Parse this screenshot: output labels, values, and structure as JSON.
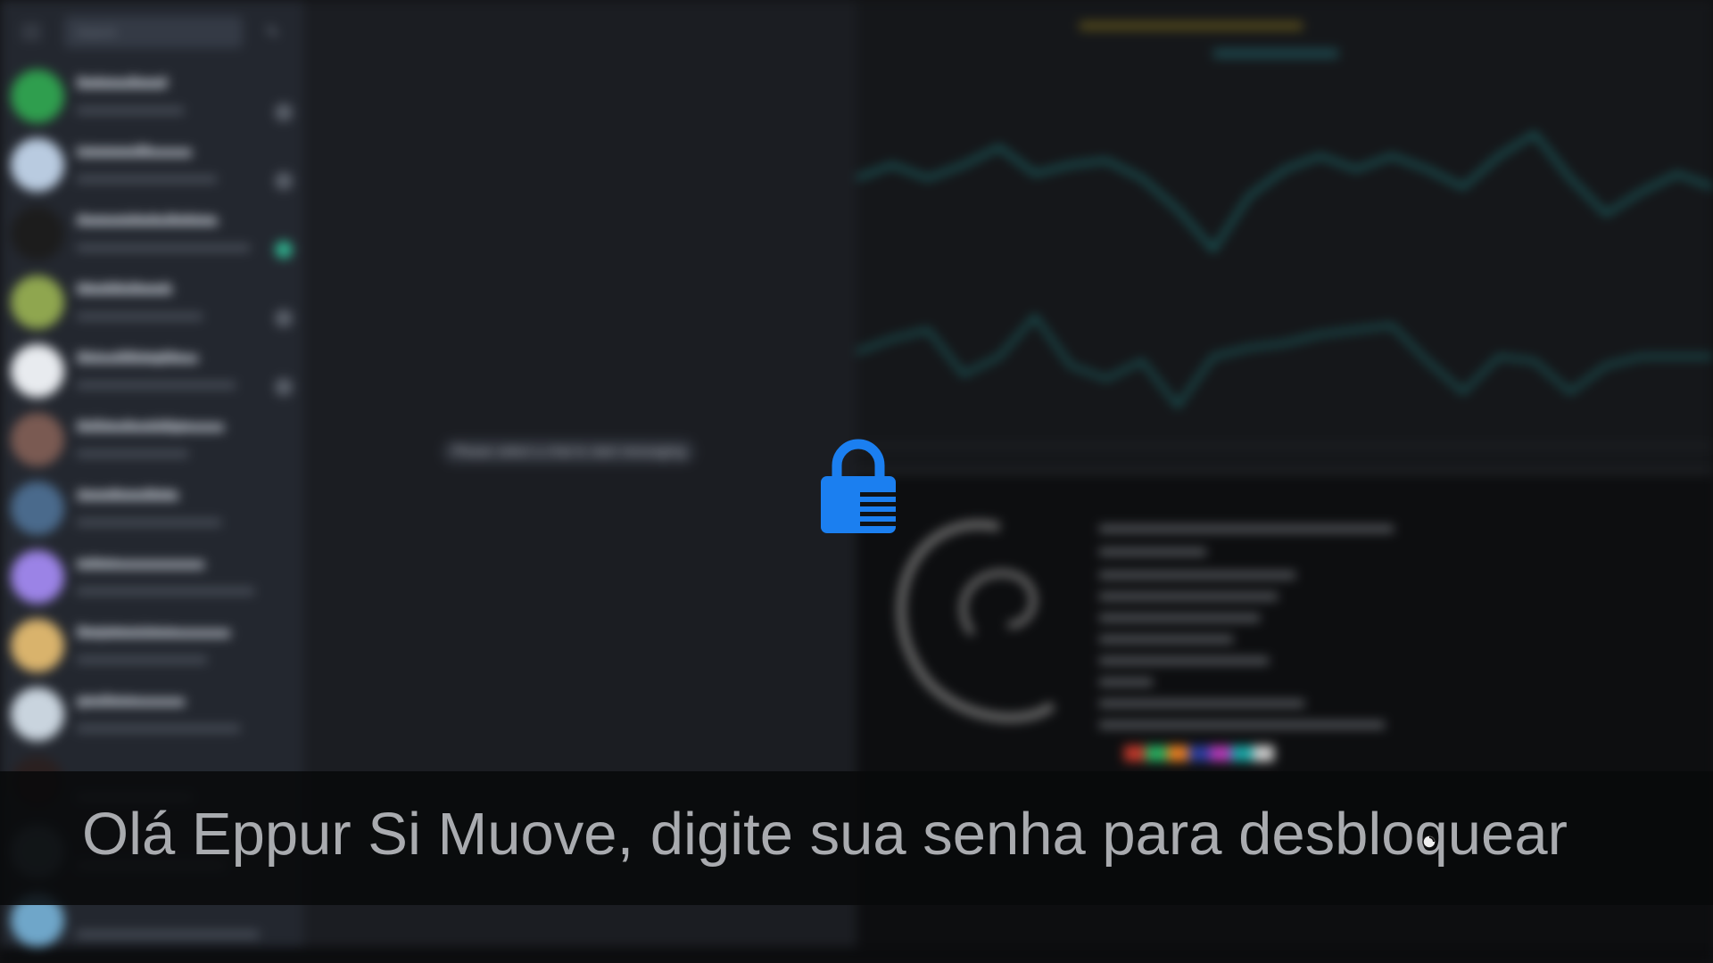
{
  "lock_screen": {
    "prompt": "Olá Eppur Si Muove, digite sua senha para desbloquear",
    "icon": "lock-icon",
    "accent_color": "#1b7ff0"
  },
  "background": {
    "sidebar": {
      "search_placeholder": "Search",
      "chats": [
        {
          "name": "Debian Brasil",
          "time": "",
          "avatar_color": "#2f9e4e",
          "badge": "muted"
        },
        {
          "name": "Lisanco 88",
          "time": "",
          "avatar_color": "#b9cbe0",
          "badge": "muted"
        },
        {
          "name": "Comunidade Debian",
          "time": "",
          "avatar_color": "#1c1c1c",
          "badge": "active"
        },
        {
          "name": "MiniOS Brasil",
          "time": "",
          "avatar_color": "#8fa64f",
          "badge": "muted"
        },
        {
          "name": "CLI + GB Inglês",
          "time": "",
          "avatar_color": "#e8ebef",
          "badge": "muted"
        },
        {
          "name": "O Fim do código",
          "time": "",
          "avatar_color": "#7a5a52",
          "badge": ""
        },
        {
          "name": "Jonathan Mata",
          "time": "",
          "avatar_color": "#4a6a8c",
          "badge": ""
        },
        {
          "name": "zelzer",
          "time": "",
          "avatar_color": "#9b83e6",
          "badge": ""
        },
        {
          "name": "Projetos Linux",
          "time": "",
          "avatar_color": "#d9b36c",
          "badge": ""
        },
        {
          "name": "gnulinux",
          "time": "",
          "avatar_color": "#c9d4de",
          "badge": ""
        },
        {
          "name": "",
          "time": "",
          "avatar_color": "#2a2020",
          "badge": ""
        },
        {
          "name": "",
          "time": "",
          "avatar_color": "#4b5a66",
          "badge": ""
        },
        {
          "name": "",
          "time": "",
          "avatar_color": "#6fa6c9",
          "badge": ""
        }
      ]
    },
    "chat_main": {
      "empty_message": "Please select a chat to start messaging"
    },
    "terminal_top": {
      "left_header": "",
      "center_header": "",
      "graph_color": "#1f8f8f"
    },
    "neofetch": {
      "palette": [
        "#c0392b",
        "#27ae60",
        "#e67e22",
        "#2c3e9e",
        "#b43bb7",
        "#1aa7a7",
        "#cfcfcf"
      ]
    }
  }
}
